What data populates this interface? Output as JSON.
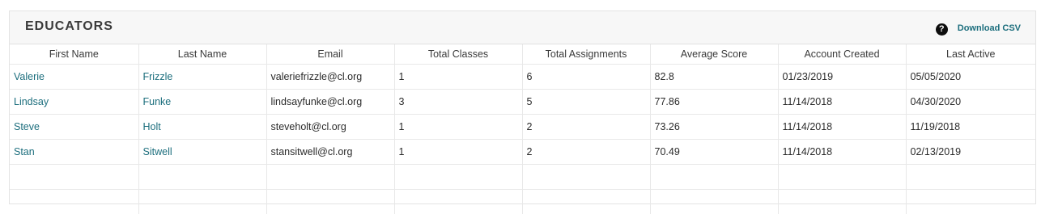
{
  "panel": {
    "title": "EDUCATORS",
    "help_icon": "question-circle-icon",
    "download_label": "Download CSV"
  },
  "table": {
    "columns": [
      "First Name",
      "Last Name",
      "Email",
      "Total Classes",
      "Total Assignments",
      "Average Score",
      "Account Created",
      "Last Active"
    ],
    "rows": [
      {
        "first_name": "Valerie",
        "last_name": "Frizzle",
        "email": "valeriefrizzle@cl.org",
        "total_classes": "1",
        "total_assignments": "6",
        "average_score": "82.8",
        "account_created": "01/23/2019",
        "last_active": "05/05/2020"
      },
      {
        "first_name": "Lindsay",
        "last_name": "Funke",
        "email": "lindsayfunke@cl.org",
        "total_classes": "3",
        "total_assignments": "5",
        "average_score": "77.86",
        "account_created": "11/14/2018",
        "last_active": "04/30/2020"
      },
      {
        "first_name": "Steve",
        "last_name": "Holt",
        "email": "steveholt@cl.org",
        "total_classes": "1",
        "total_assignments": "2",
        "average_score": "73.26",
        "account_created": "11/14/2018",
        "last_active": "11/19/2018"
      },
      {
        "first_name": "Stan",
        "last_name": "Sitwell",
        "email": "stansitwell@cl.org",
        "total_classes": "1",
        "total_assignments": "2",
        "average_score": "70.49",
        "account_created": "11/14/2018",
        "last_active": "02/13/2019"
      }
    ]
  },
  "colors": {
    "link": "#1c6e7d",
    "header_bg": "#f7f7f7",
    "border": "#e8e8e8"
  }
}
